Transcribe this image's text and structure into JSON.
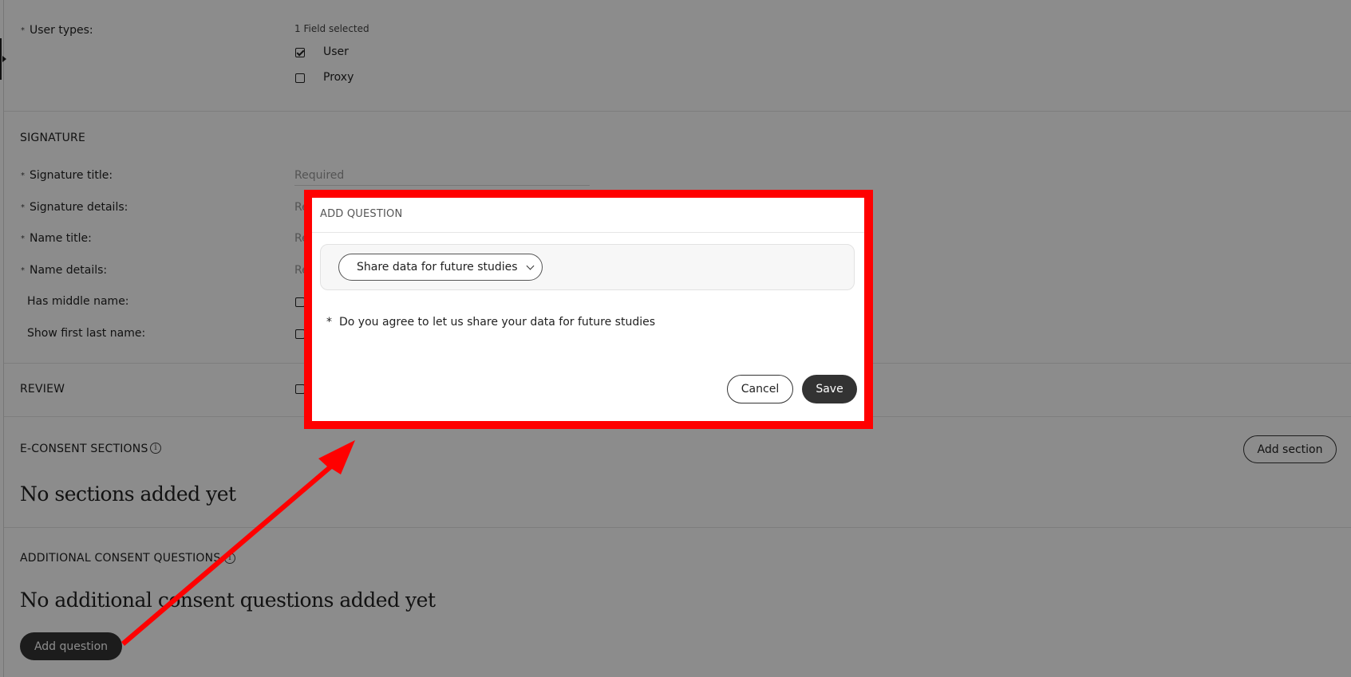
{
  "user_types": {
    "label": "User types:",
    "selected_count": "1 Field selected",
    "options": [
      {
        "label": "User",
        "checked": true
      },
      {
        "label": "Proxy",
        "checked": false
      }
    ]
  },
  "signature": {
    "section_title": "SIGNATURE",
    "fields": [
      {
        "label": "Signature title:",
        "required": true,
        "placeholder": "Required"
      },
      {
        "label": "Signature details:",
        "required": true,
        "placeholder": "Re"
      },
      {
        "label": "Name title:",
        "required": true,
        "placeholder": "Re"
      },
      {
        "label": "Name details:",
        "required": true,
        "placeholder": "Re"
      },
      {
        "label": "Has middle name:",
        "required": false
      },
      {
        "label": "Show first last name:",
        "required": false
      }
    ],
    "required_mark": "*"
  },
  "review": {
    "section_title": "REVIEW"
  },
  "econsent": {
    "section_title": "E-CONSENT SECTIONS",
    "info_icon": "info-icon",
    "add_button": "Add section",
    "empty_text": "No sections added yet"
  },
  "additional": {
    "section_title": "ADDITIONAL CONSENT QUESTIONS",
    "info_icon": "info-icon",
    "empty_text": "No additional consent questions added yet",
    "add_button": "Add question"
  },
  "modal": {
    "title": "ADD QUESTION",
    "selected_question": "Share data for future studies",
    "chevron_icon": "chevron-down-icon",
    "question_star": "*",
    "question_text": "Do you agree to let us share your data for future studies",
    "cancel_label": "Cancel",
    "save_label": "Save"
  },
  "annotation": {
    "highlight_color": "#ff0000",
    "arrow_color": "#ff0000"
  }
}
